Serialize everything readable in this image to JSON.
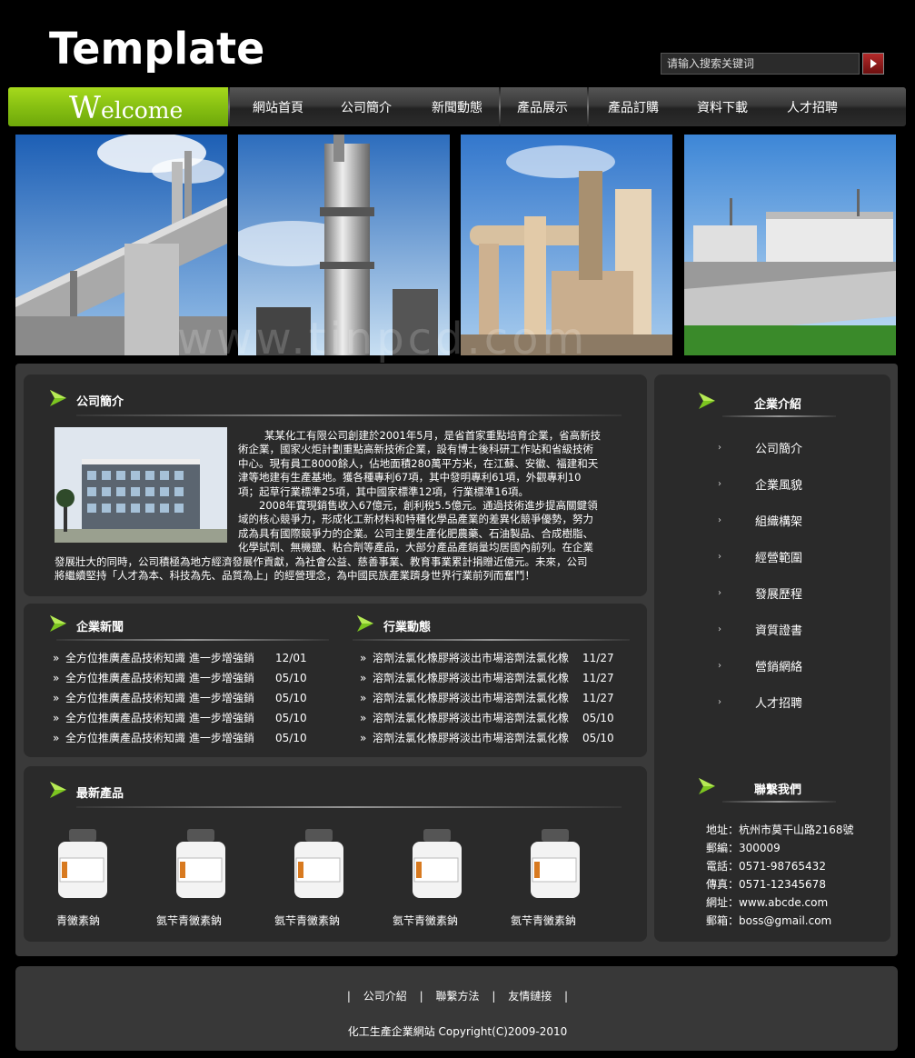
{
  "header": {
    "logo": "Template",
    "search_placeholder": "请输入搜索关键词"
  },
  "nav": {
    "welcome": "Welcome",
    "items": [
      "網站首頁",
      "公司簡介",
      "新聞動態",
      "產品展示",
      "產品訂購",
      "資料下載",
      "人才招聘"
    ]
  },
  "banner": {
    "watermark": "www.tinpcd.com"
  },
  "intro": {
    "title": "公司簡介",
    "lines": [
      "某某化工有限公司創建於2001年5月，是省首家重點培育企業，省高新技",
      "術企業，國家火炬計劃重點高新技術企業，設有博士後科研工作站和省級技術",
      "中心。現有員工8000餘人，佔地面積280萬平方米，在江蘇、安徽、福建和天",
      "津等地建有生產基地。獲各種專利67項，其中發明專利61項，外觀專利10",
      "項；起草行業標準25項，其中國家標準12項，行業標準16項。",
      "2008年實現銷售收入67億元，創利稅5.5億元。通過技術進步提高關鍵領",
      "域的核心競爭力，形成化工新材料和特種化學品產業的差異化競爭優勢，努力",
      "成為具有國際競爭力的企業。公司主要生產化肥農藥、石油製品、合成樹脂、",
      "化學試劑、無機鹽、粘合劑等產品，大部分產品產銷量均居國內前列。在企業",
      "發展壯大的同時，公司積極為地方經濟發展作貢獻，為社會公益、慈善事業、教育事業累計捐贈近億元。未來，公司",
      "將繼續堅持「人才為本、科技為先、品質為上」的經營理念，為中國民族產業躋身世界行業前列而奮鬥！"
    ]
  },
  "company_news": {
    "title": "企業新聞",
    "items": [
      {
        "text": "全方位推廣產品技術知識 進一步增強銷",
        "date": "12/01"
      },
      {
        "text": "全方位推廣產品技術知識 進一步增強銷",
        "date": "05/10"
      },
      {
        "text": "全方位推廣產品技術知識 進一步增強銷",
        "date": "05/10"
      },
      {
        "text": "全方位推廣產品技術知識 進一步增強銷",
        "date": "05/10"
      },
      {
        "text": "全方位推廣產品技術知識 進一步增強銷",
        "date": "05/10"
      }
    ]
  },
  "industry_news": {
    "title": "行業動態",
    "items": [
      {
        "text": "溶劑法氯化橡膠將淡出市場溶劑法氯化橡",
        "date": "11/27"
      },
      {
        "text": "溶劑法氯化橡膠將淡出市場溶劑法氯化橡",
        "date": "11/27"
      },
      {
        "text": "溶劑法氯化橡膠將淡出市場溶劑法氯化橡",
        "date": "11/27"
      },
      {
        "text": "溶劑法氯化橡膠將淡出市場溶劑法氯化橡",
        "date": "05/10"
      },
      {
        "text": "溶劑法氯化橡膠將淡出市場溶劑法氯化橡",
        "date": "05/10"
      }
    ]
  },
  "products": {
    "title": "最新產品",
    "items": [
      "青黴素鈉",
      "氨芐青黴素鈉",
      "氨芐青黴素鈉",
      "氨芐青黴素鈉",
      "氨芐青黴素鈉"
    ]
  },
  "sidebar": {
    "title": "企業介紹",
    "items": [
      "公司簡介",
      "企業風貌",
      "組織構架",
      "經營範圍",
      "發展歷程",
      "資質證書",
      "營銷網絡",
      "人才招聘"
    ],
    "bullet": "›"
  },
  "contact": {
    "title": "聯繫我們",
    "rows": [
      "地址：杭州市莫干山路2168號",
      "郵編：300009",
      "電話：0571-98765432",
      "傳真：0571-12345678",
      "網址：www.abcde.com",
      "郵箱：boss@gmail.com"
    ]
  },
  "footer": {
    "sep": "|",
    "links": [
      "公司介紹",
      "聯繫方法",
      "友情鏈接"
    ],
    "copyright": "化工生產企業網站 Copyright(C)2009-2010"
  },
  "colors": {
    "accent_green": "#8cc614",
    "nav_dark": "#2c2c2c",
    "panel": "#2a2a2a"
  }
}
